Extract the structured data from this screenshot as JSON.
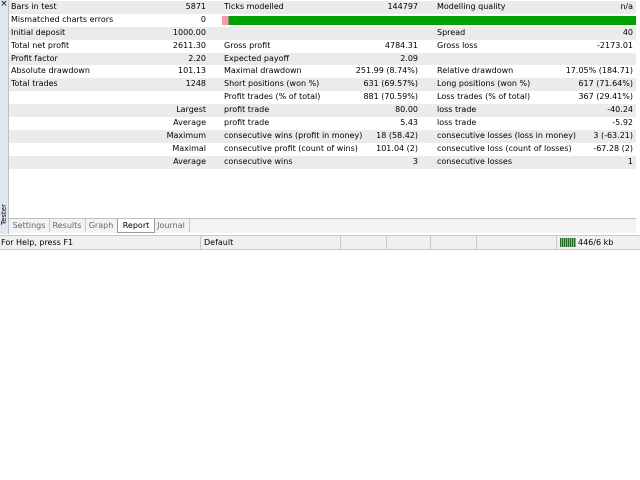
{
  "side": {
    "label": "Tester"
  },
  "report": {
    "rows": [
      {
        "c1": "Bars in test",
        "v1": "5871",
        "c2": "Ticks modelled",
        "v2": "144797",
        "c3": "Modelling quality",
        "v3": "n/a"
      },
      {
        "c1": "Mismatched charts errors",
        "v1": "0"
      },
      {
        "c1": "Initial deposit",
        "v1": "1000.00",
        "c3": "Spread",
        "v3": "40"
      },
      {
        "c1": "Total net profit",
        "v1": "2611.30",
        "c2": "Gross profit",
        "v2": "4784.31",
        "c3": "Gross loss",
        "v3": "-2173.01"
      },
      {
        "c1": "Profit factor",
        "v1": "2.20",
        "c2": "Expected payoff",
        "v2": "2.09"
      },
      {
        "c1": "Absolute drawdown",
        "v1": "101.13",
        "c2": "Maximal drawdown",
        "v2": "251.99 (8.74%)",
        "c3": "Relative drawdown",
        "v3": "17.05% (184.71)"
      },
      {
        "c1": "Total trades",
        "v1": "1248",
        "c2": "Short positions (won %)",
        "v2": "631 (69.57%)",
        "c3": "Long positions (won %)",
        "v3": "617 (71.64%)"
      },
      {
        "c2": "Profit trades (% of total)",
        "v2": "881 (70.59%)",
        "c3": "Loss trades (% of total)",
        "v3": "367 (29.41%)"
      },
      {
        "v1": "Largest",
        "c2": "profit trade",
        "v2": "80.00",
        "c3": "loss trade",
        "v3": "-40.24"
      },
      {
        "v1": "Average",
        "c2": "profit trade",
        "v2": "5.43",
        "c3": "loss trade",
        "v3": "-5.92"
      },
      {
        "v1": "Maximum",
        "c2": "consecutive wins (profit in money)",
        "v2": "18 (58.42)",
        "c3": "consecutive losses (loss in money)",
        "v3": "3 (-63.21)"
      },
      {
        "v1": "Maximal",
        "c2": "consecutive profit (count of wins)",
        "v2": "101.04 (2)",
        "c3": "consecutive loss (count of losses)",
        "v3": "-67.28 (2)"
      },
      {
        "v1": "Average",
        "c2": "consecutive wins",
        "v2": "3",
        "c3": "consecutive losses",
        "v3": "1"
      }
    ]
  },
  "tabs": [
    {
      "label": "Settings"
    },
    {
      "label": "Results"
    },
    {
      "label": "Graph"
    },
    {
      "label": "Report",
      "active": true
    },
    {
      "label": "Journal"
    }
  ],
  "status": {
    "help": "For Help, press F1",
    "profile": "Default",
    "traffic": "446/6 kb"
  },
  "colors": {
    "quality_bar": "#00a000",
    "quality_marker": "#f0a0a0"
  }
}
